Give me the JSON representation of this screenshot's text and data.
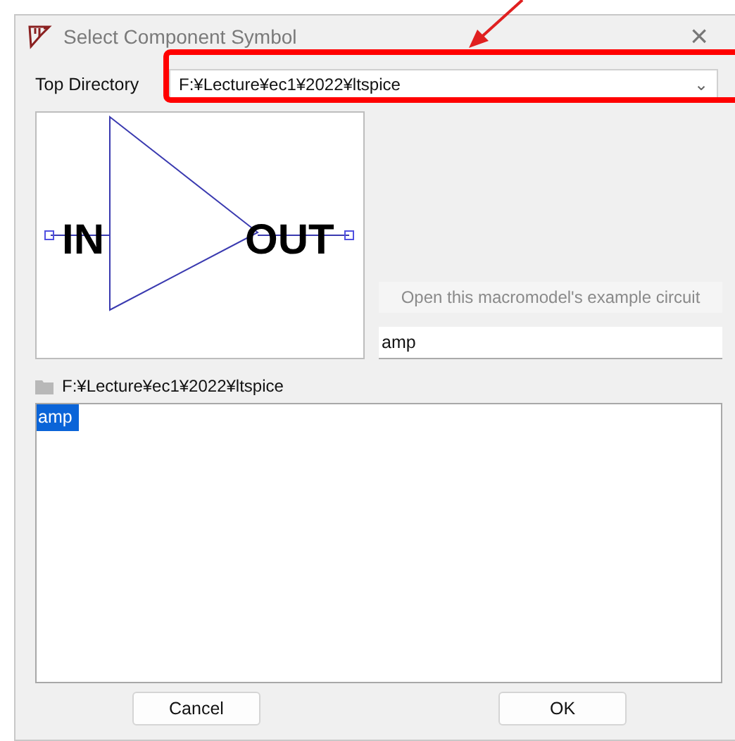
{
  "window": {
    "title": "Select Component Symbol",
    "close": "×"
  },
  "top_directory": {
    "label": "Top Directory",
    "value": "F:¥Lecture¥ec1¥2022¥ltspice",
    "caret": "⌄"
  },
  "symbol_preview": {
    "pins": [
      {
        "label": "IN"
      },
      {
        "label": "OUT"
      }
    ]
  },
  "example_button": {
    "label": "Open this macromodel's example circuit",
    "disabled": true
  },
  "name_field": {
    "value": "amp"
  },
  "folder_path": "F:¥Lecture¥ec1¥2022¥ltspice",
  "files": [
    {
      "name": "amp",
      "selected": true
    }
  ],
  "buttons": [
    {
      "label": "Cancel"
    },
    {
      "label": "OK"
    }
  ]
}
